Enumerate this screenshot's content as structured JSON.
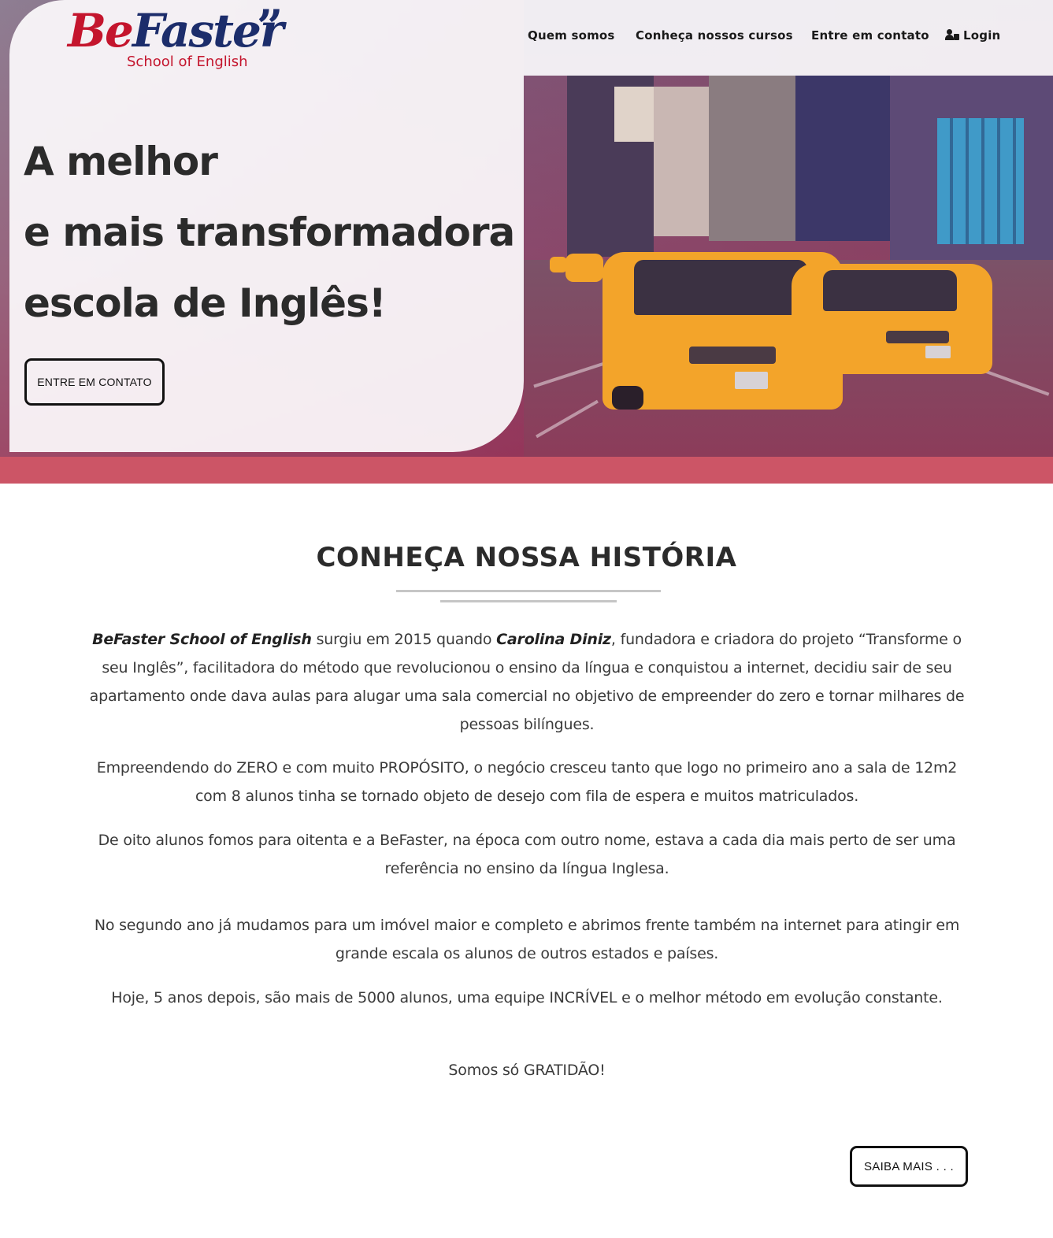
{
  "brand": {
    "logo_be": "Be",
    "logo_faster": "Faster",
    "logo_quote": "”",
    "logo_sub": "School of English",
    "red": "#c4152d",
    "navy": "#1c2d6b"
  },
  "nav": {
    "items": [
      {
        "label": "Quem somos"
      },
      {
        "label": "Conheça nossos cursos"
      },
      {
        "label": "Entre em contato"
      }
    ],
    "login_label": "Login",
    "login_icon": "user-lock-icon"
  },
  "hero": {
    "lines": [
      "A melhor",
      "e mais transformadora",
      "escola de Inglês!"
    ],
    "cta_label": "ENTRE EM CONTATO",
    "band_color": "#cc5566"
  },
  "history": {
    "title": "CONHEÇA NOSSA HISTÓRIA",
    "p1_brand": "BeFaster School of English",
    "p1_a": " surgiu em 2015 quando ",
    "p1_name": "Carolina Diniz",
    "p1_b": ", fundadora e criadora do projeto “Transforme o seu Inglês”, facilitadora do método que revolucionou o ensino da língua e conquistou a internet, decidiu sair de seu apartamento onde dava aulas para alugar uma sala comercial no objetivo de empreender do zero e tornar milhares de pessoas bilíngues.",
    "p2": "Empreendendo do ZERO e com muito PROPÓSITO, o negócio cresceu tanto que logo no primeiro ano a sala de 12m2 com 8 alunos tinha se tornado objeto de desejo com fila de espera e muitos matriculados.",
    "p3": "De oito alunos fomos para oitenta e a BeFaster, na época com outro nome, estava a cada dia mais perto de ser uma referência no ensino da língua Inglesa.",
    "p4": "No segundo ano já mudamos para um imóvel maior e completo e abrimos frente também na internet para atingir em grande escala os alunos de outros estados e países.",
    "p5": "Hoje, 5 anos depois, são mais de 5000 alunos, uma equipe INCRÍVEL e o melhor método em evolução constante.",
    "p6": "Somos só GRATIDÃO!",
    "more_label": "SAIBA MAIS . . ."
  }
}
